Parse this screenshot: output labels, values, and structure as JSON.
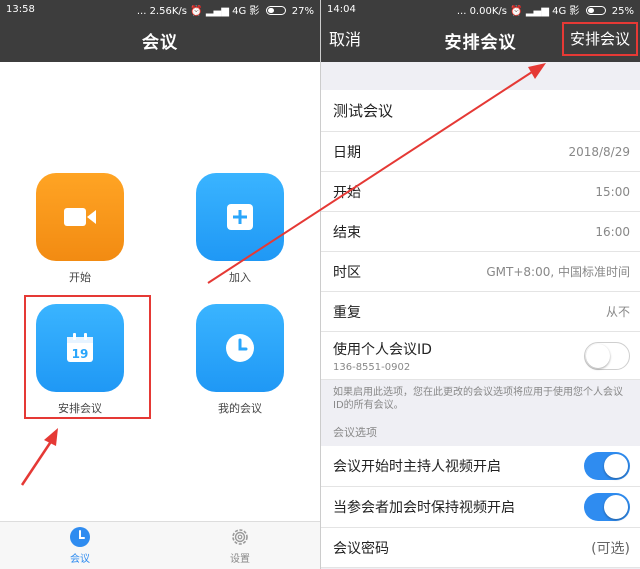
{
  "colors": {
    "navbar": "#3d3d3d",
    "accent_blue": "#2f8cf0",
    "tile_orange": "#f59a1a",
    "tile_blue": "#2aa6fb",
    "annotation_red": "#e53935"
  },
  "left": {
    "status": {
      "time": "13:58",
      "speed": "... 2.56K/s",
      "network": "4G",
      "extra": "影",
      "battery": "27%"
    },
    "title": "会议",
    "tiles": [
      {
        "label": "开始",
        "icon": "video-camera-icon"
      },
      {
        "label": "加入",
        "icon": "plus-icon"
      },
      {
        "label": "安排会议",
        "icon": "calendar-icon",
        "calendar_day": "19"
      },
      {
        "label": "我的会议",
        "icon": "clock-icon"
      }
    ],
    "tabs": [
      {
        "label": "会议",
        "icon": "clock-icon",
        "active": true
      },
      {
        "label": "设置",
        "icon": "gear-icon",
        "active": false
      }
    ]
  },
  "right": {
    "status": {
      "time": "14:04",
      "speed": "... 0.00K/s",
      "network": "4G",
      "extra": "影",
      "battery": "25%"
    },
    "cancel": "取消",
    "title": "安排会议",
    "schedule": "安排会议",
    "topic": "测试会议",
    "rows": {
      "date": {
        "label": "日期",
        "value": "2018/8/29"
      },
      "start": {
        "label": "开始",
        "value": "15:00"
      },
      "end": {
        "label": "结束",
        "value": "16:00"
      },
      "timezone": {
        "label": "时区",
        "value": "GMT+8:00, 中国标准时间"
      },
      "repeat": {
        "label": "重复",
        "value": "从不"
      }
    },
    "pmi": {
      "label": "使用个人会议ID",
      "id": "136-8551-0902",
      "enabled": false
    },
    "pmi_note": "如果启用此选项，您在此更改的会议选项将应用于使用您个人会议ID的所有会议。",
    "options_header": "会议选项",
    "options": [
      {
        "label": "会议开始时主持人视频开启",
        "enabled": true
      },
      {
        "label": "当参会者加会时保持视频开启",
        "enabled": true
      }
    ],
    "password": {
      "label": "会议密码",
      "value": "(可选)"
    }
  }
}
